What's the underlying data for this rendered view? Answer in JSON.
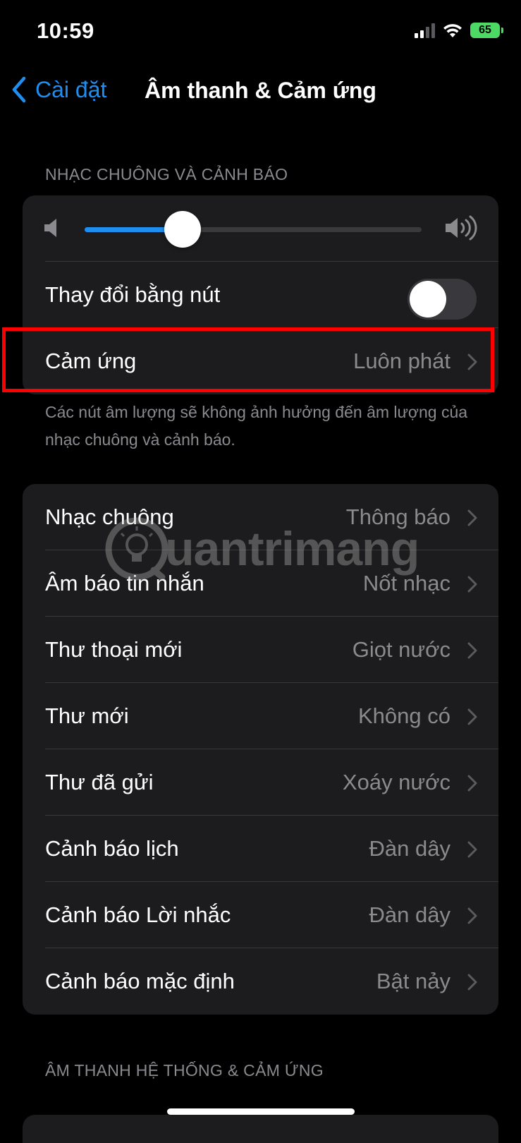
{
  "status_bar": {
    "time": "10:59",
    "battery": "65",
    "icons": [
      "cellular-signal-icon",
      "wifi-icon",
      "battery-charging-icon"
    ]
  },
  "nav": {
    "back_label": "Cài đặt",
    "title": "Âm thanh & Cảm ứng"
  },
  "section1": {
    "header": "NHẠC CHUÔNG VÀ CẢNH BÁO",
    "volume_level": 0.29,
    "change_with_buttons": {
      "label": "Thay đổi bằng nút",
      "enabled": false
    },
    "haptics": {
      "label": "Cảm ứng",
      "value": "Luôn phát"
    },
    "footer": "Các nút âm lượng sẽ không ảnh hưởng đến âm lượng của nhạc chuông và cảnh báo."
  },
  "sounds": [
    {
      "label": "Nhạc chuông",
      "value": "Thông báo"
    },
    {
      "label": "Âm báo tin nhắn",
      "value": "Nốt nhạc"
    },
    {
      "label": "Thư thoại mới",
      "value": "Giọt nước"
    },
    {
      "label": "Thư mới",
      "value": "Không có"
    },
    {
      "label": "Thư đã gửi",
      "value": "Xoáy nước"
    },
    {
      "label": "Cảnh báo lịch",
      "value": "Đàn dây"
    },
    {
      "label": "Cảnh báo Lời nhắc",
      "value": "Đàn dây"
    },
    {
      "label": "Cảnh báo mặc định",
      "value": "Bật nảy"
    }
  ],
  "section3": {
    "header": "ÂM THANH HỆ THỐNG & CẢM ỨNG"
  },
  "watermark": "uantrimang",
  "colors": {
    "accent": "#1f8ef1",
    "highlight": "#ff0000",
    "battery": "#4cd964",
    "cell_bg": "#1c1c1e",
    "secondary_text": "#8a8a8f"
  }
}
